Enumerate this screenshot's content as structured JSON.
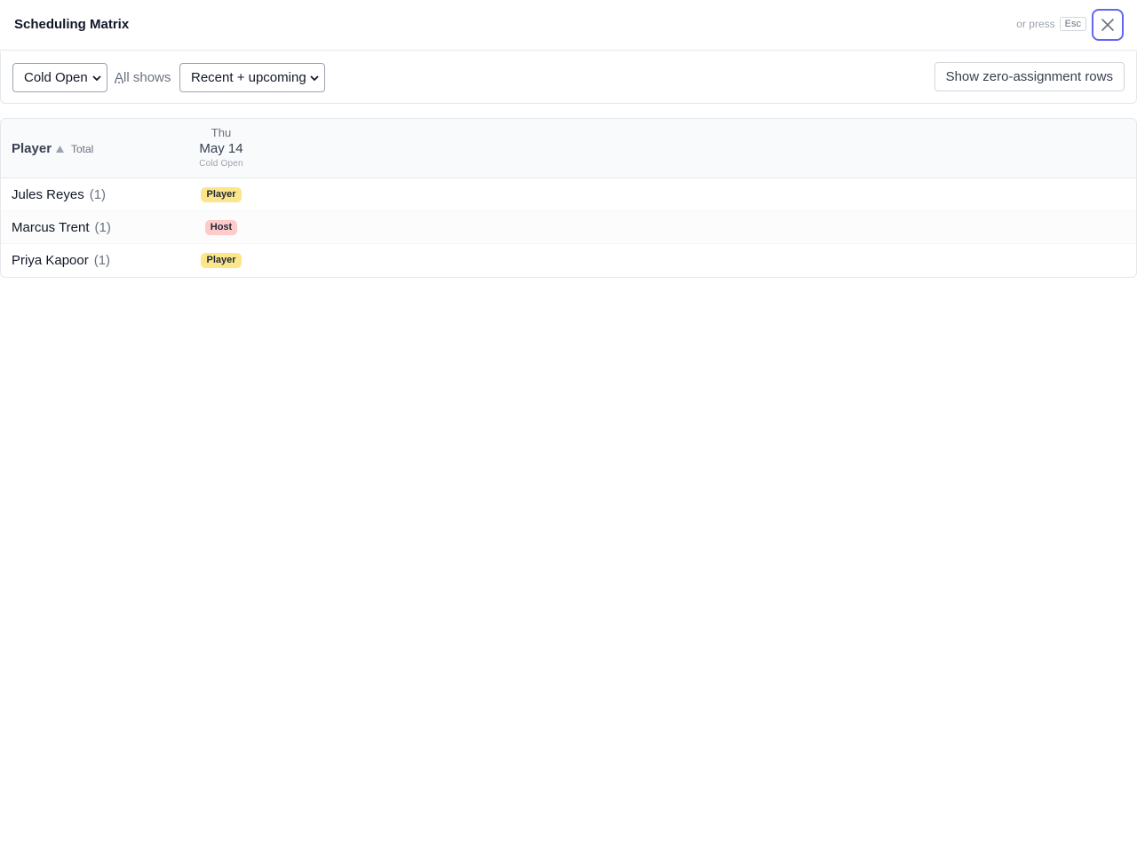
{
  "header": {
    "title": "Scheduling Matrix",
    "esc_prefix": "or press",
    "esc_key": "Esc",
    "close_icon": "close-icon"
  },
  "toolbar": {
    "show_select": {
      "selected": "Cold Open"
    },
    "all_shows_accesskey": "A",
    "all_shows_rest": "ll shows",
    "range_select": {
      "selected": "Recent + upcoming"
    },
    "zero_rows_button": "Show zero-assignment rows"
  },
  "matrix": {
    "columns": {
      "player": "Player",
      "total": "Total",
      "sort_icon": "sort-ascending-icon"
    },
    "dates": [
      {
        "dow": "Thu",
        "date": "May 14",
        "show": "Cold Open"
      }
    ],
    "rows": [
      {
        "name": "Jules Reyes",
        "count": "(1)",
        "role": "Player",
        "role_color": "#fde68a"
      },
      {
        "name": "Marcus Trent",
        "count": "(1)",
        "role": "Host",
        "role_color": "#fecaca"
      },
      {
        "name": "Priya Kapoor",
        "count": "(1)",
        "role": "Player",
        "role_color": "#fde68a"
      }
    ]
  },
  "colors": {
    "accent": "#6366f1",
    "player_badge": "#fde68a",
    "host_badge": "#fecaca"
  }
}
